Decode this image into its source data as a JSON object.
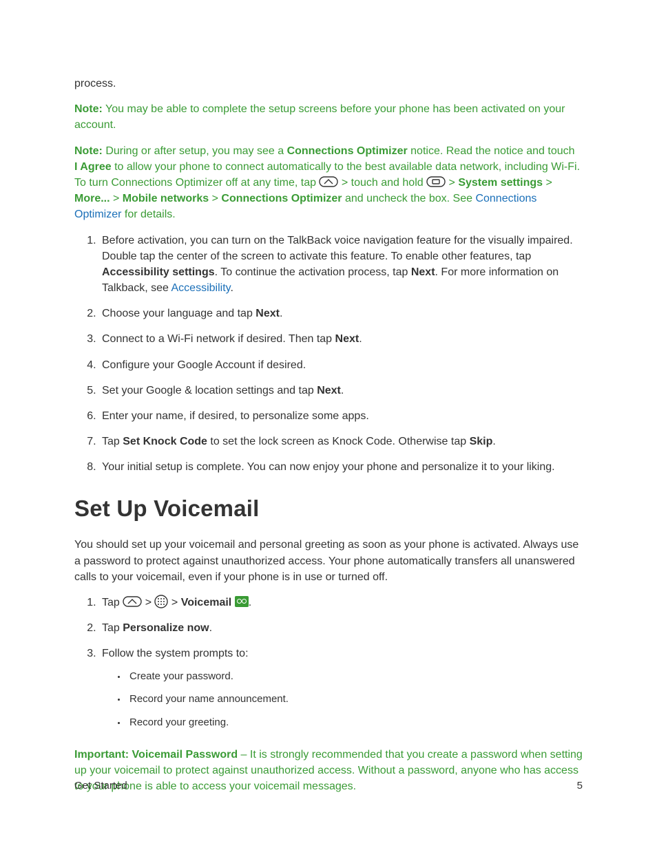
{
  "intro": {
    "process": "process."
  },
  "note1": {
    "label": "Note:",
    "text": " You may be able to complete the setup screens before your phone has been activated on your account."
  },
  "note2": {
    "label": "Note:",
    "text_a": " During or after setup, you may see a ",
    "conn_opt": "Connections Optimizer",
    "text_b": " notice. Read the notice and touch",
    "iagree": "I Agree",
    "text_c": " to allow your phone to connect automatically to the best available data network, including Wi-Fi. To turn Connections Optimizer off at any time, tap ",
    "text_d": " > touch and hold ",
    "text_e": " > ",
    "sys_settings": "System settings",
    "gt1": " > ",
    "more": "More...",
    "gt2": " > ",
    "mobile_net": "Mobile networks",
    "gt3": " > ",
    "conn_opt2": "Connections Optimizer",
    "text_f": " and uncheck the box. See ",
    "link": "Connections Optimizer",
    "text_g": " for details."
  },
  "steps1": [
    {
      "a": "Before activation, you can turn on the TalkBack voice navigation feature for the visually impaired. Double tap the center of the screen to activate this feature. To enable other features, tap ",
      "b": "Accessibility settings",
      "c": ". To continue the activation process, tap ",
      "d": "Next",
      "e": ". For more information on Talkback, see ",
      "link": "Accessibility",
      "f": "."
    },
    {
      "a": "Choose your language and tap ",
      "b": "Next",
      "c": "."
    },
    {
      "a": "Connect to a Wi-Fi network if desired. Then tap ",
      "b": "Next",
      "c": "."
    },
    {
      "a": "Configure your Google Account if desired."
    },
    {
      "a": "Set your Google & location settings and tap ",
      "b": "Next",
      "c": "."
    },
    {
      "a": "Enter your name, if desired, to personalize some apps."
    },
    {
      "a": "Tap ",
      "b": "Set Knock Code",
      "c": " to set the lock screen as Knock Code. Otherwise tap ",
      "d": "Skip",
      "e": "."
    },
    {
      "a": "Your initial setup is complete. You can now enjoy your phone and personalize it to your liking."
    }
  ],
  "heading": "Set Up Voicemail",
  "vm_intro": "You should set up your voicemail and personal greeting as soon as your phone is activated. Always use a password to protect against unauthorized access. Your phone automatically transfers all unanswered calls to your voicemail, even if your phone is in use or turned off.",
  "steps2": {
    "s1": {
      "a": "Tap ",
      "gt1": " > ",
      "gt2": " > ",
      "vm": "Voicemail",
      "dot": "."
    },
    "s2": {
      "a": "Tap ",
      "b": "Personalize now",
      "c": "."
    },
    "s3": {
      "a": "Follow the system prompts to:",
      "b1": "Create your password.",
      "b2": "Record your name announcement.",
      "b3": "Record your greeting."
    }
  },
  "important": {
    "label": "Important:",
    "title": " Voicemail Password",
    "text": " – It is strongly recommended that you create a password when setting up your voicemail to protect against unauthorized access. Without a password, anyone who has access to your phone is able to access your voicemail messages."
  },
  "footer": {
    "section": "Get Started",
    "page": "5"
  }
}
